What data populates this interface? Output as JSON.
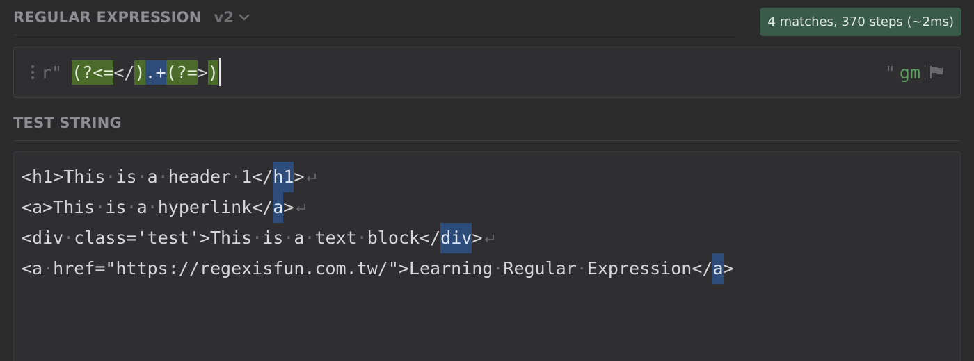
{
  "regex_section": {
    "title": "REGULAR EXPRESSION",
    "version": "v2",
    "status": "4 matches, 370 steps (~2ms)",
    "prefix": "r\"",
    "suffix": "\"",
    "flags": "gm",
    "tokens": [
      {
        "text": "(?<=",
        "style": "green"
      },
      {
        "text": "</",
        "style": "plain"
      },
      {
        "text": ")",
        "style": "green"
      },
      {
        "text": ".+",
        "style": "blue"
      },
      {
        "text": "(?=",
        "style": "green"
      },
      {
        "text": ">",
        "style": "plain"
      },
      {
        "text": ")",
        "style": "green"
      }
    ]
  },
  "test_section": {
    "title": "TEST STRING",
    "lines": [
      {
        "segments": [
          {
            "text": "<h1>This is a header 1</",
            "match": false
          },
          {
            "text": "h1",
            "match": true
          },
          {
            "text": ">",
            "match": false
          }
        ],
        "newline": true
      },
      {
        "segments": [
          {
            "text": "<a>This is a hyperlink</",
            "match": false
          },
          {
            "text": "a",
            "match": true
          },
          {
            "text": ">",
            "match": false
          }
        ],
        "newline": true
      },
      {
        "segments": [
          {
            "text": "<div class='test'>This is a text block</",
            "match": false
          },
          {
            "text": "div",
            "match": true
          },
          {
            "text": ">",
            "match": false
          }
        ],
        "newline": true
      },
      {
        "segments": [
          {
            "text": "<a href=\"https://regexisfun.com.tw/\">Learning Regular Expression</",
            "match": false
          },
          {
            "text": "a",
            "match": true
          },
          {
            "text": ">",
            "match": false
          }
        ],
        "newline": false
      }
    ]
  },
  "icons": {
    "version_toggle": "chevron-down-icon",
    "drag_handle": "drag-handle-icon",
    "flags_menu": "flag-icon",
    "newline_marker": "newline-icon"
  },
  "colors": {
    "background": "#2b2b2c",
    "status_badge": "#3b5b4a",
    "group_highlight": "#4b6b2a",
    "match_highlight": "#2e4c7a",
    "flags_text": "#5f9a5f"
  }
}
